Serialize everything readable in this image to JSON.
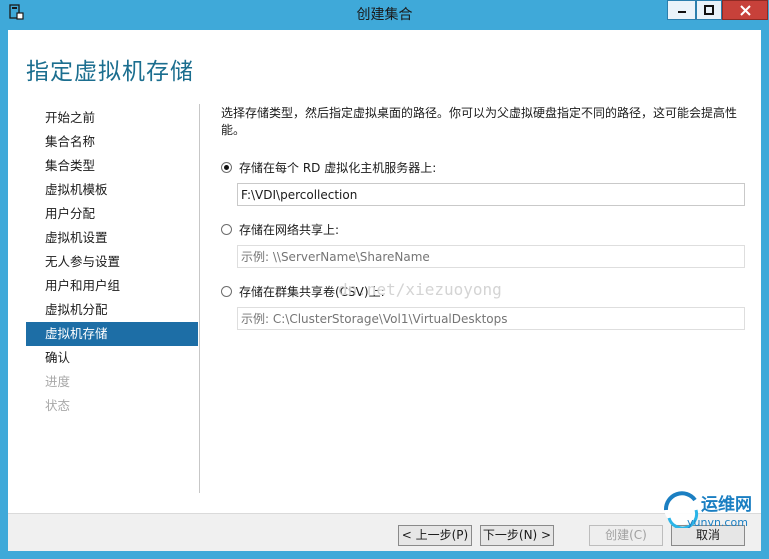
{
  "window": {
    "title": "创建集合",
    "icons": {
      "app": "server-manager-icon",
      "min": "minimize-icon",
      "max": "maximize-icon",
      "close": "close-icon"
    }
  },
  "page": {
    "heading": "指定虚拟机存储",
    "description": "选择存储类型，然后指定虚拟桌面的路径。你可以为父虚拟硬盘指定不同的路径，这可能会提高性能。"
  },
  "nav": {
    "items": [
      {
        "label": "开始之前",
        "state": "normal"
      },
      {
        "label": "集合名称",
        "state": "normal"
      },
      {
        "label": "集合类型",
        "state": "normal"
      },
      {
        "label": "虚拟机模板",
        "state": "normal"
      },
      {
        "label": "用户分配",
        "state": "normal"
      },
      {
        "label": "虚拟机设置",
        "state": "normal"
      },
      {
        "label": "无人参与设置",
        "state": "normal"
      },
      {
        "label": "用户和用户组",
        "state": "normal"
      },
      {
        "label": "虚拟机分配",
        "state": "normal"
      },
      {
        "label": "虚拟机存储",
        "state": "active"
      },
      {
        "label": "确认",
        "state": "normal"
      },
      {
        "label": "进度",
        "state": "disabled"
      },
      {
        "label": "状态",
        "state": "disabled"
      }
    ]
  },
  "storage": {
    "options": [
      {
        "label": "存储在每个 RD 虚拟化主机服务器上:",
        "checked": true,
        "value": "F:\\VDI\\percollection",
        "placeholder": ""
      },
      {
        "label": "存储在网络共享上:",
        "checked": false,
        "value": "",
        "placeholder": "示例: \\\\ServerName\\ShareName"
      },
      {
        "label": "存储在群集共享卷(CSV)上:",
        "checked": false,
        "value": "",
        "placeholder": "示例: C:\\ClusterStorage\\Vol1\\VirtualDesktops"
      }
    ]
  },
  "watermark": "dn.net/xiezuoyong",
  "footer": {
    "prev": "< 上一步(P)",
    "next": "下一步(N) >",
    "create": "创建(C)",
    "cancel": "取消"
  },
  "logo": {
    "text": "运维网",
    "url": "yunvn.com"
  },
  "colors": {
    "titlebar": "#3fa9d9",
    "accent": "#1d6ea6",
    "heading": "#1b6e8f",
    "close": "#c7413a"
  }
}
